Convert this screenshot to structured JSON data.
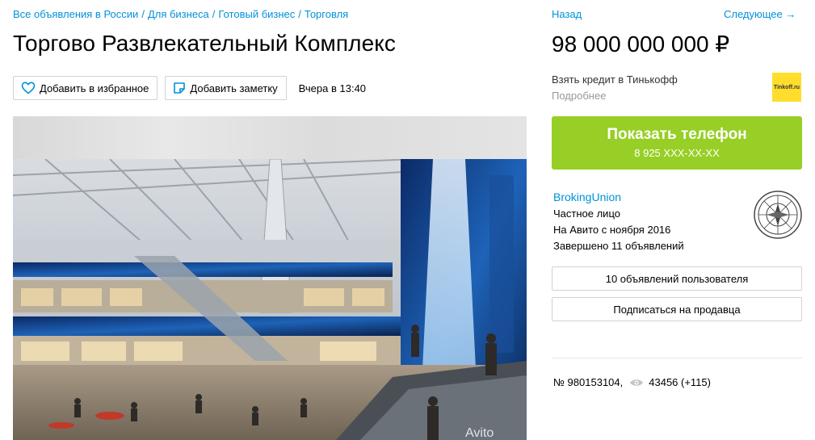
{
  "breadcrumbs": [
    "Все объявления в России",
    "Для бизнеса",
    "Готовый бизнес",
    "Торговля"
  ],
  "breadcrumb_separator": "/",
  "title": "Торгово Развлекательный Комплекс",
  "actions": {
    "favorite_label": "Добавить в избранное",
    "note_label": "Добавить заметку",
    "posted": "Вчера в 13:40"
  },
  "gallery": {
    "watermark": "Avito"
  },
  "nav": {
    "back_label": "Назад",
    "next_label": "Следующее →"
  },
  "price": "98 000 000 000 ₽",
  "credit": {
    "offer": "Взять кредит в Тинькофф",
    "details": "Подробнее",
    "logo_text": "Tinkoff.ru"
  },
  "phone": {
    "label": "Показать телефон",
    "number": "8 925 XXX-XX-XX"
  },
  "seller": {
    "name": "BrokingUnion",
    "type": "Частное лицо",
    "since": "На Авито с ноября 2016",
    "completed": "Завершено 11 объявлений"
  },
  "buttons": {
    "user_ads": "10 объявлений пользователя",
    "subscribe": "Подписаться на продавца"
  },
  "stats": {
    "ad_number": "№ 980153104,",
    "views": "43456 (+115)"
  },
  "colors": {
    "link": "#0091d9",
    "phone_button": "#97cf26",
    "tinkoff": "#ffdd2d"
  }
}
